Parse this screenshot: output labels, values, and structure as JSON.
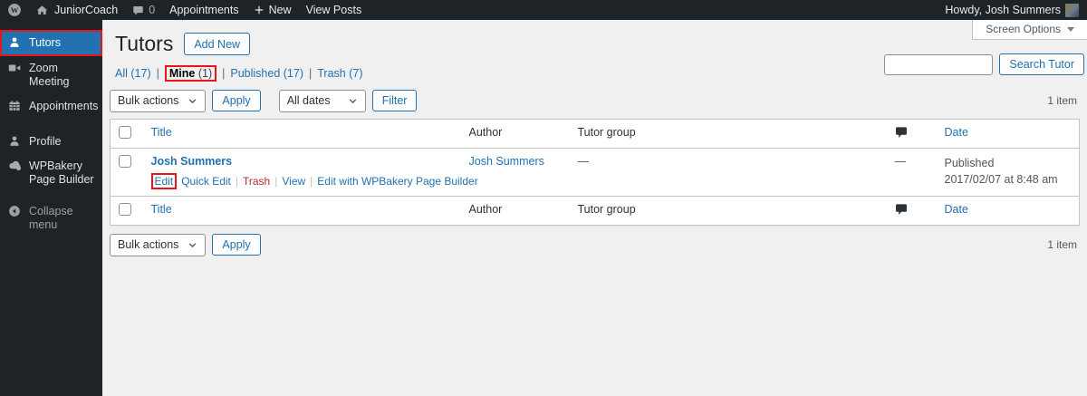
{
  "colors": {
    "admin_dark": "#1d2327",
    "active_blue": "#2271b1",
    "link_blue": "#2271b1",
    "trash_red": "#b32d2e",
    "annotation_red": "#e8161b",
    "content_bg": "#f0f0f1"
  },
  "admin_bar": {
    "site_name": "JuniorCoach",
    "comments_count": "0",
    "appointments_label": "Appointments",
    "new_label": "New",
    "view_posts_label": "View Posts",
    "howdy": "Howdy, Josh Summers"
  },
  "screen_options": {
    "label": "Screen Options"
  },
  "sidebar": {
    "items": [
      {
        "label": "Tutors",
        "icon": "person-icon",
        "active": true
      },
      {
        "label": "Zoom Meeting",
        "icon": "video-icon",
        "active": false
      },
      {
        "label": "Appointments",
        "icon": "calendar-icon",
        "active": false
      },
      {
        "label": "Profile",
        "icon": "person-icon",
        "active": false
      },
      {
        "label": "WPBakery Page Builder",
        "icon": "cloud-icon",
        "active": false
      },
      {
        "label": "Collapse menu",
        "icon": "collapse-arrow-icon",
        "active": false
      }
    ]
  },
  "page": {
    "title": "Tutors",
    "add_new_label": "Add New",
    "filters": [
      {
        "label": "All",
        "count": "(17)"
      },
      {
        "label": "Mine",
        "count": "(1)"
      },
      {
        "label": "Published",
        "count": "(17)"
      },
      {
        "label": "Trash",
        "count": "(7)"
      }
    ],
    "filter_separator": "|",
    "bulk_actions_label": "Bulk actions",
    "apply_label": "Apply",
    "all_dates_label": "All dates",
    "filter_label": "Filter",
    "search_value": "",
    "search_button_label": "Search Tutor",
    "item_count": "1 item"
  },
  "table": {
    "headers": {
      "title": "Title",
      "author": "Author",
      "tutor_group": "Tutor group",
      "date": "Date"
    },
    "action_separator": "|",
    "rows": [
      {
        "title": "Josh Summers",
        "actions": {
          "edit": "Edit",
          "quick_edit": "Quick Edit",
          "trash": "Trash",
          "view": "View",
          "wpbakery": "Edit with WPBakery Page Builder"
        },
        "author": "Josh Summers",
        "tutor_group": "—",
        "comments": "—",
        "status": "Published",
        "date": "2017/02/07 at 8:48 am"
      }
    ]
  }
}
